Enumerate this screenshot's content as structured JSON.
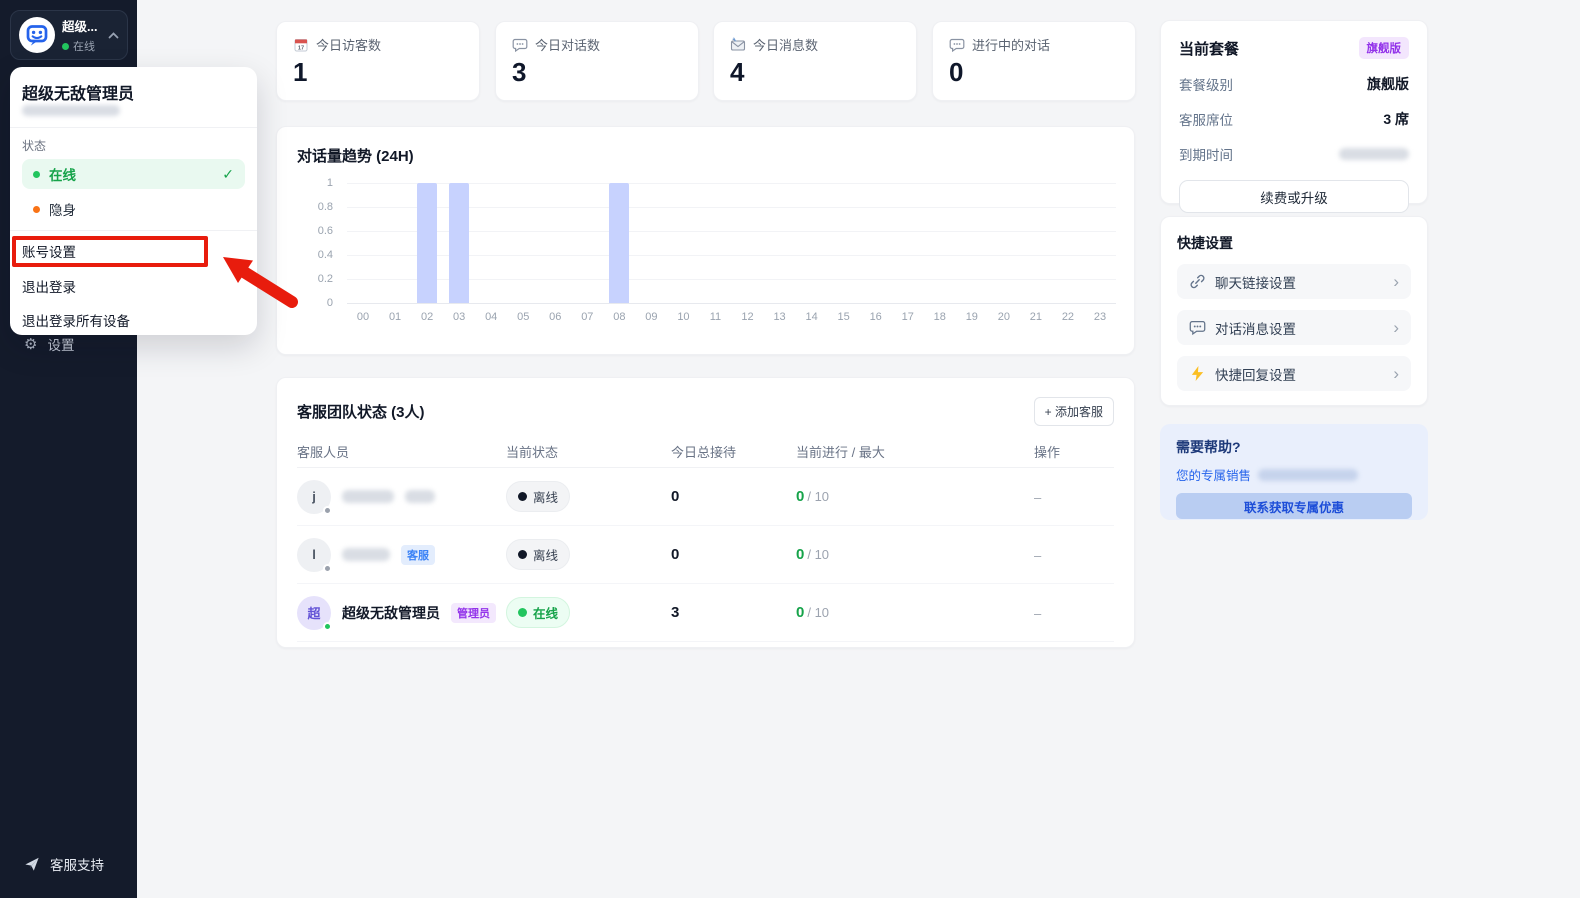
{
  "sidebar": {
    "user_name_short": "超级...",
    "user_status": "在线",
    "settings_label": "设置",
    "support_label": "客服支持"
  },
  "user_menu": {
    "name": "超级无敌管理员",
    "status_section_label": "状态",
    "status_online": "在线",
    "status_invisible": "隐身",
    "item_account_settings": "账号设置",
    "item_logout": "退出登录",
    "item_logout_all_devices": "退出登录所有设备"
  },
  "annotation": {
    "type": "highlight-box-and-arrow",
    "target": "账号设置",
    "color": "#e81c0d"
  },
  "stats": [
    {
      "icon": "calendar-icon",
      "label": "今日访客数",
      "value": "1"
    },
    {
      "icon": "chat-bubble-icon",
      "label": "今日对话数",
      "value": "3"
    },
    {
      "icon": "envelope-icon",
      "label": "今日消息数",
      "value": "4"
    },
    {
      "icon": "chat-bubble-icon",
      "label": "进行中的对话",
      "value": "0"
    }
  ],
  "chart_data": {
    "type": "bar",
    "title": "对话量趋势 (24H)",
    "categories": [
      "00",
      "01",
      "02",
      "03",
      "04",
      "05",
      "06",
      "07",
      "08",
      "09",
      "10",
      "11",
      "12",
      "13",
      "14",
      "15",
      "16",
      "17",
      "18",
      "19",
      "20",
      "21",
      "22",
      "23"
    ],
    "values": [
      0,
      0,
      1,
      1,
      0,
      0,
      0,
      0,
      1,
      0,
      0,
      0,
      0,
      0,
      0,
      0,
      0,
      0,
      0,
      0,
      0,
      0,
      0,
      0
    ],
    "xlabel": "",
    "ylabel": "",
    "ylim": [
      0,
      1
    ],
    "yticks": [
      0,
      0.2,
      0.4,
      0.6,
      0.8,
      1
    ],
    "grid": true,
    "legend": false,
    "bar_color": "#c7d2fe"
  },
  "team": {
    "title": "客服团队状态 (3人)",
    "add_button": "+ 添加客服",
    "columns": [
      "客服人员",
      "当前状态",
      "今日总接待",
      "当前进行 / 最大",
      "操作"
    ],
    "rows": [
      {
        "avatar_letter": "j",
        "name_redacted": true,
        "role_badge": "",
        "status": "离线",
        "status_type": "offline",
        "today_total": "0",
        "current": "0",
        "max_display": "/ 10",
        "action": "–"
      },
      {
        "avatar_letter": "l",
        "name_redacted": true,
        "role_badge": "客服",
        "status": "离线",
        "status_type": "offline",
        "today_total": "0",
        "current": "0",
        "max_display": "/ 10",
        "action": "–"
      },
      {
        "avatar_letter": "超",
        "name": "超级无敌管理员",
        "role_badge": "管理员",
        "status": "在线",
        "status_type": "online",
        "today_total": "3",
        "current": "0",
        "max_display": "/ 10",
        "action": "–"
      }
    ]
  },
  "plan": {
    "title": "当前套餐",
    "badge": "旗舰版",
    "level_label": "套餐级别",
    "level_value": "旗舰版",
    "seats_label": "客服席位",
    "seats_value": "3 席",
    "expire_label": "到期时间",
    "expire_value_redacted": true,
    "renew_button": "续费或升级"
  },
  "quick_settings": {
    "title": "快捷设置",
    "items": [
      {
        "icon": "link-icon",
        "label": "聊天链接设置"
      },
      {
        "icon": "chat-bubble-icon",
        "label": "对话消息设置"
      },
      {
        "icon": "lightning-icon",
        "label": "快捷回复设置"
      }
    ]
  },
  "help": {
    "title": "需要帮助?",
    "sales_label": "您的专属销售",
    "sales_value_redacted": true,
    "contact_button": "联系获取专属优惠"
  },
  "colors": {
    "sidebar_bg": "#141b2b",
    "brand_blue": "#2563eb",
    "accent_green": "#16a34a",
    "status_orange": "#f97316",
    "bar": "#c7d2fe",
    "annotation_red": "#e81c0d",
    "badge_purple": "#9333ea",
    "badge_blue": "#3b82f6"
  }
}
